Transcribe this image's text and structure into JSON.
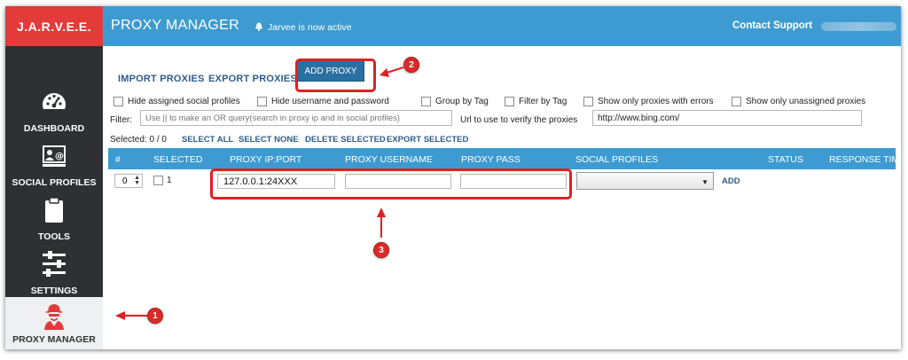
{
  "app": {
    "brand": "J.A.R.V.E.E.",
    "page_title": "PROXY MANAGER",
    "status_message": "Jarvee is now active",
    "contact_support": "Contact Support"
  },
  "sidebar": {
    "items": [
      {
        "label": "DASHBOARD",
        "icon": "dashboard-gauge-icon"
      },
      {
        "label": "SOCIAL PROFILES",
        "icon": "social-profiles-icon"
      },
      {
        "label": "TOOLS",
        "icon": "clipboard-icon"
      },
      {
        "label": "SETTINGS",
        "icon": "sliders-icon"
      },
      {
        "label": "PROXY MANAGER",
        "icon": "spy-agent-icon",
        "active": true
      }
    ]
  },
  "toolbar": {
    "import": "IMPORT PROXIES",
    "export": "EXPORT PROXIES",
    "add": "ADD PROXY"
  },
  "options": [
    "Hide assigned social profiles",
    "Hide username and password",
    "Group by Tag",
    "Filter by Tag",
    "Show only proxies with errors",
    "Show only unassigned proxies"
  ],
  "filter": {
    "label": "Filter:",
    "placeholder": "Use || to make an OR query(search in proxy ip and in social profiles)",
    "verify_label": "Url to use to verify the proxies",
    "verify_value": "http://www.bing.com/"
  },
  "selection": {
    "text": "Selected:  0 / 0",
    "select_all": "SELECT ALL",
    "select_none": "SELECT NONE",
    "delete_selected": "DELETE SELECTED",
    "export_selected": "EXPORT SELECTED"
  },
  "table": {
    "headers": [
      "#",
      "SELECTED",
      "PROXY IP:PORT",
      "PROXY USERNAME",
      "PROXY PASS",
      "SOCIAL PROFILES",
      "STATUS",
      "RESPONSE TIM"
    ],
    "row": {
      "num": "0",
      "index": "1",
      "ip_port": "127.0.0.1:24XXX",
      "username": "",
      "password": "",
      "social_profile": "",
      "add": "ADD"
    }
  },
  "annotations": {
    "badges": [
      "1",
      "2",
      "3"
    ],
    "color": "#e02020"
  },
  "colors": {
    "brand_red": "#e23b3a",
    "header_blue": "#3d9bd1",
    "sidebar_dark": "#2e3033",
    "link_blue": "#2d5d8c"
  }
}
